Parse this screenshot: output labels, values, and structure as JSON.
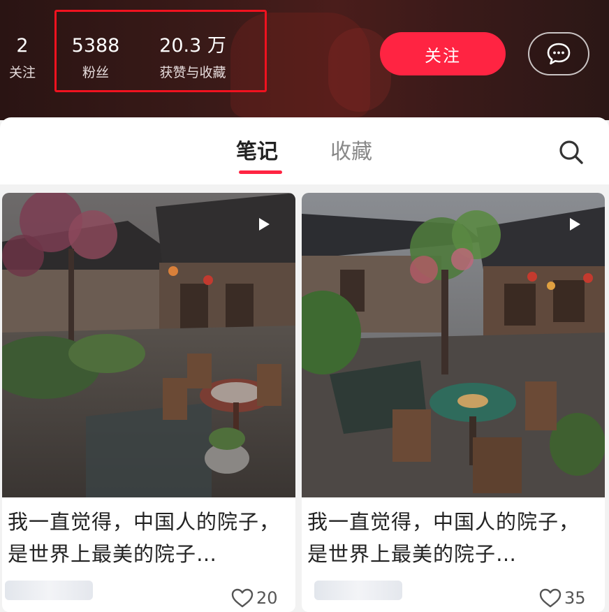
{
  "profile": {
    "following_count": "2",
    "following_label": "关注",
    "fans_count": "5388",
    "fans_label": "粉丝",
    "likes_count": "20.3 万",
    "likes_label": "获赞与收藏",
    "follow_button": "关注",
    "message_icon": "chat-bubble-icon"
  },
  "tabs": {
    "items": [
      {
        "label": "笔记",
        "active": true
      },
      {
        "label": "收藏",
        "active": false
      }
    ],
    "search_icon": "search-icon"
  },
  "notes": [
    {
      "title": "我一直觉得，中国人的院子，是世界上最美的院子…",
      "likes": "20",
      "is_video": true
    },
    {
      "title": "我一直觉得，中国人的院子，是世界上最美的院子…",
      "likes": "35",
      "is_video": true
    }
  ],
  "colors": {
    "accent": "#ff2442",
    "highlight_box": "#f0121f",
    "header_bg": "#3a1a18"
  }
}
